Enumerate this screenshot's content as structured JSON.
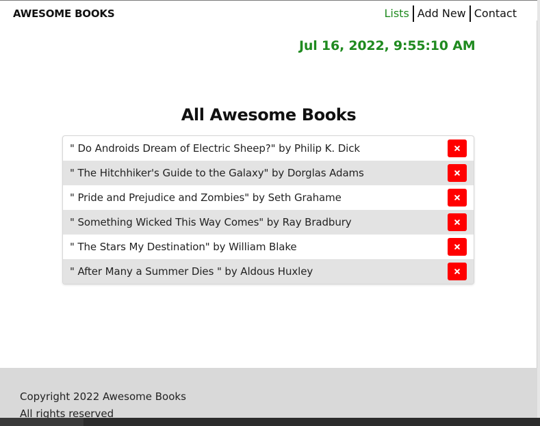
{
  "header": {
    "logo": "AWESOME BOOKS",
    "nav": [
      {
        "label": "Lists",
        "active": true
      },
      {
        "label": "Add New",
        "active": false
      },
      {
        "label": "Contact",
        "active": false
      }
    ]
  },
  "datetime": "Jul 16, 2022, 9:55:10 AM",
  "main": {
    "title": "All Awesome Books",
    "books": [
      {
        "text": "\" Do Androids Dream of Electric Sheep?\" by Philip K. Dick"
      },
      {
        "text": "\" The Hitchhiker's Guide to the Galaxy\" by Dorglas Adams"
      },
      {
        "text": "\" Pride and Prejudice and Zombies\" by Seth Grahame"
      },
      {
        "text": "\" Something Wicked This Way Comes\" by Ray Bradbury"
      },
      {
        "text": "\" The Stars My Destination\" by William Blake"
      },
      {
        "text": "\" After Many a Summer Dies \" by Aldous Huxley"
      }
    ],
    "remove_icon": "close-icon"
  },
  "footer": {
    "line1": "Copyright 2022 Awesome Books",
    "line2": "All rights reserved"
  },
  "colors": {
    "accent_green": "#1f8a1f",
    "remove_red": "#ff0000",
    "alt_row": "#e3e3e3",
    "footer_bg": "#d9d9d9"
  }
}
